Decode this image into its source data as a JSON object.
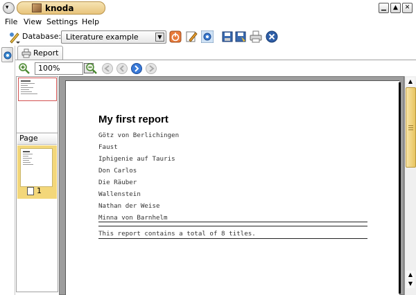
{
  "window": {
    "title": "knoda"
  },
  "menu": {
    "items": [
      "File",
      "View",
      "Settings",
      "Help"
    ]
  },
  "toolbar": {
    "database_label": "Database:",
    "database_value": "Literature example"
  },
  "report_tab": {
    "label": "Report"
  },
  "preview": {
    "zoom": "100%"
  },
  "thumbnails": {
    "page_header": "Page",
    "pages": [
      "1"
    ]
  },
  "report": {
    "title": "My first report",
    "titles": [
      "Götz von Berlichingen",
      "Faust",
      "Iphigenie auf Tauris",
      "Don Carlos",
      "Die Räuber",
      "Wallenstein",
      "Nathan der Weise",
      "Minna von Barnhelm"
    ],
    "summary": "This report contains a total of 8 titles."
  },
  "colors": {
    "accent": "#e8c460",
    "thumb_selected": "#f3d77a",
    "selected_border": "#d25050"
  }
}
